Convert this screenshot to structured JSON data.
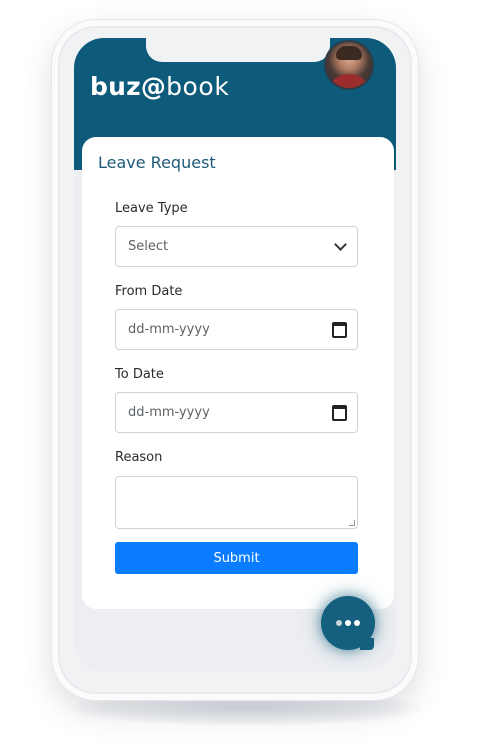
{
  "app": {
    "brand_part1": "buz",
    "brand_at": "@",
    "brand_part2": "book"
  },
  "form": {
    "title": "Leave Request",
    "leave_type_label": "Leave Type",
    "leave_type_value": "Select",
    "from_date_label": "From Date",
    "from_date_placeholder": "dd-mm-yyyy",
    "to_date_label": "To Date",
    "to_date_placeholder": "dd-mm-yyyy",
    "reason_label": "Reason",
    "reason_value": "",
    "submit_label": "Submit"
  },
  "icons": {
    "select": "chevron-down-icon",
    "date": "calendar-icon",
    "chat": "chat-icon",
    "avatar": "avatar"
  },
  "colors": {
    "header": "#0e5a7b",
    "title": "#1d5b78",
    "submit": "#0a7cff",
    "chat": "#155f7f"
  }
}
